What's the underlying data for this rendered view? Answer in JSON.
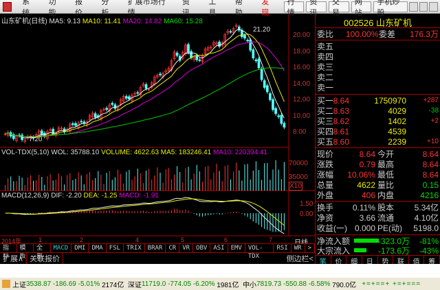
{
  "menu": {
    "items": [
      "系统",
      "功能",
      "报价",
      "分析",
      "扩展市场行情",
      "资讯",
      "工具",
      "帮助"
    ],
    "discover": "发现",
    "right_buttons": [
      "行情",
      "资讯",
      "交易",
      "网站",
      "手机炒股"
    ]
  },
  "price_chart": {
    "title": "山东矿机(日线)",
    "ma5": "MA5: 9.13",
    "ma10": "MA10: 11.41",
    "ma20": "MA20: 14.82",
    "ma60": "MA60: 15.28",
    "high_label": "21.20",
    "low_label": "7.20",
    "axis": [
      "20.00",
      "18.00",
      "16.00",
      "14.00",
      "12.00",
      "10.00",
      "8.00"
    ],
    "price_keypoints": [
      7.8,
      7.6,
      7.4,
      7.3,
      7.2,
      7.5,
      7.9,
      7.7,
      8.1,
      8.0,
      8.4,
      8.3,
      8.8,
      9.2,
      9.0,
      9.6,
      10.2,
      10.0,
      10.8,
      11.4,
      11.0,
      11.8,
      12.5,
      12.2,
      13.0,
      13.8,
      13.4,
      14.2,
      15.5,
      15.0,
      16.4,
      17.8,
      17.2,
      18.6,
      17.5,
      16.8,
      17.6,
      18.4,
      19.2,
      18.6,
      19.8,
      20.6,
      21.2,
      20.4,
      19.5,
      18.0,
      16.5,
      14.5,
      12.6,
      11.0,
      9.6,
      8.64
    ]
  },
  "volume": {
    "title": "VOL-TDX(5,10)",
    "wol": "WOL: 35788.10",
    "volume": "VOLUME: 4622.63",
    "ma5": "MA5: 183246.41",
    "ma10": "MA10: 220394.41",
    "axis": [
      "70000",
      "35000"
    ],
    "unit": "X10"
  },
  "macd": {
    "title": "MACD(12,26,9)",
    "dif": "DIF: -2.20",
    "dea": "DEA: -1.25",
    "macd": "MACD: -1.91",
    "axis": [
      "1.50",
      "0.00"
    ]
  },
  "date_axis": {
    "labels": [
      "2014年",
      "1",
      "2",
      "4",
      "5",
      "6",
      "7"
    ],
    "period": "日线"
  },
  "indicator_tabs": [
    "指标",
    "模板",
    "全部",
    "MACD",
    "DMI",
    "DMA",
    "FSL",
    "TRIX",
    "BRAR",
    "CR",
    "VR",
    "OBV",
    "ASI",
    "EMV",
    "VOL-TDX",
    "RSI",
    "WR",
    ">"
  ],
  "ext_tabs": [
    "扩展∧",
    "关联报价"
  ],
  "side_toggle": "侧边栏<",
  "stock": {
    "code": "002526",
    "name": "山东矿机"
  },
  "weibi": {
    "label": "委比",
    "value": "100.00%",
    "diff_label": "委差",
    "diff": "176.3万"
  },
  "sells": [
    "卖五",
    "卖四",
    "卖三",
    "卖二",
    "卖一"
  ],
  "buys": [
    {
      "label": "买一",
      "price": "8.64",
      "vol": "1750970",
      "chg": "+287"
    },
    {
      "label": "买二",
      "price": "8.63",
      "vol": "4029",
      "chg": "-38"
    },
    {
      "label": "买三",
      "price": "8.62",
      "vol": "1402",
      "chg": "+2"
    },
    {
      "label": "买四",
      "price": "8.61",
      "vol": "4539",
      "chg": ""
    },
    {
      "label": "买五",
      "price": "8.60",
      "vol": "2239",
      "chg": "+10"
    }
  ],
  "quote": [
    [
      "现价",
      "8.64",
      "今开",
      "8.64"
    ],
    [
      "涨跌",
      "0.79",
      "最高",
      "8.64"
    ],
    [
      "涨幅",
      "10.06%",
      "最低",
      "8.64"
    ],
    [
      "总量",
      "4622",
      "量比",
      "0.15"
    ],
    [
      "外盘",
      "406",
      "内盘",
      "4216"
    ]
  ],
  "fund": [
    [
      "换手",
      "0.11%",
      "股本",
      "5.34亿"
    ],
    [
      "净资",
      "3.66",
      "流通",
      "4.10亿"
    ],
    [
      "收益(一)",
      "0.000",
      "PE(动)",
      "5198.0"
    ]
  ],
  "flow": [
    {
      "label": "净流入额",
      "value": "-323.0万",
      "pct": "-81%"
    },
    {
      "label": "大宗流入",
      "value": "-173.6万",
      "pct": "-43%"
    }
  ],
  "panel_tabs": [
    "笔",
    "价",
    "细",
    "日",
    "势",
    "联",
    "值",
    "筹"
  ],
  "status": {
    "sh_label": "上证",
    "sh": "3538.87 -186.69 -5.01%",
    "sh_amt": "2174亿",
    "sz_label": "深证",
    "sz": "11719.0 -774.05 -6.20%",
    "sz_amt": "1981亿",
    "zx_label": "中小",
    "zx": "7819.73 -550.88 -6.58%",
    "zx_amt": "790.0亿"
  }
}
